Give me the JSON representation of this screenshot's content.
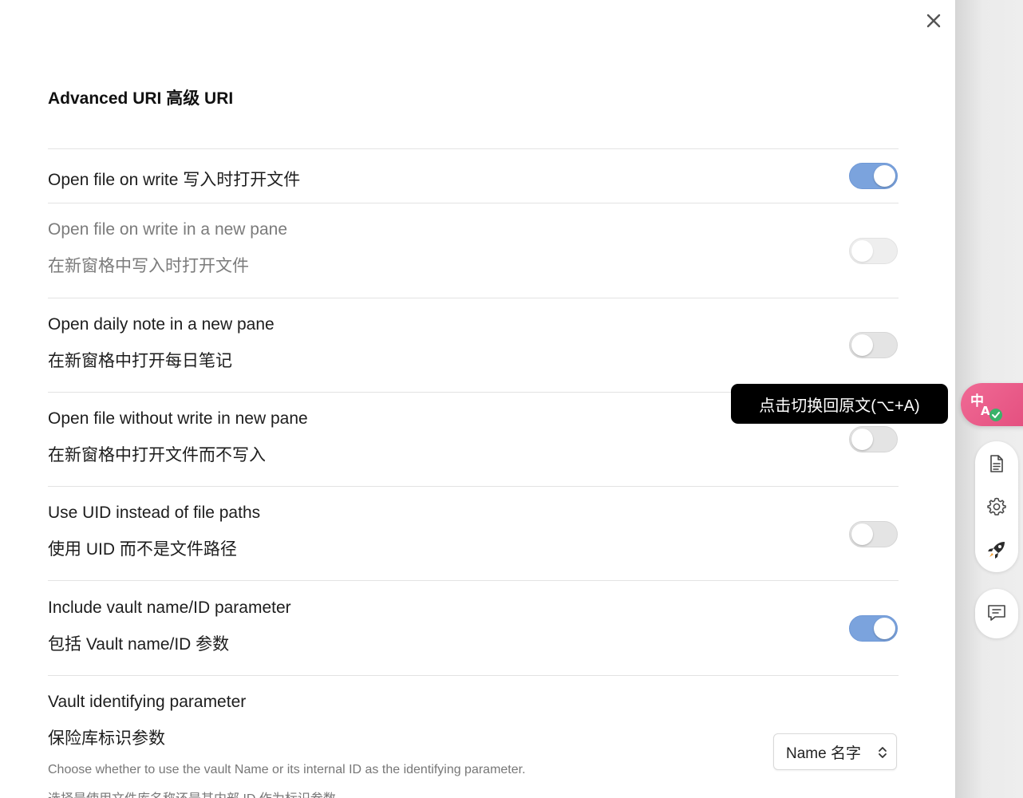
{
  "heading": "Advanced URI  高级 URI",
  "settings": [
    {
      "title": "Open file on write  写入时打开文件",
      "subtitle": "",
      "state": "on"
    },
    {
      "title": "Open file on write in a new pane",
      "subtitle": "在新窗格中写入时打开文件",
      "state": "disabled"
    },
    {
      "title": "Open daily note in a new pane",
      "subtitle": "在新窗格中打开每日笔记",
      "state": "off"
    },
    {
      "title": "Open file without write in new pane",
      "subtitle": "在新窗格中打开文件而不写入",
      "state": "off"
    },
    {
      "title": "Use UID instead of file paths",
      "subtitle": "使用 UID 而不是文件路径",
      "state": "off"
    },
    {
      "title": "Include vault name/ID parameter",
      "subtitle": "包括 Vault name/ID 参数",
      "state": "on"
    }
  ],
  "vault_param": {
    "title": "Vault identifying parameter",
    "subtitle": "保险库标识参数",
    "description": "Choose whether to use the vault Name or its internal ID as the identifying parameter.",
    "description_cn": "选择是使用文件库名称还是其内部 ID 作为标识参数",
    "select_value": "Name  名字"
  },
  "tooltip": "点击切换回原文(⌥+A)",
  "icons": {
    "close": "close-icon",
    "translate": "translate-icon",
    "document": "document-icon",
    "settings": "gear-icon",
    "rocket": "rocket-icon",
    "chat": "chat-icon"
  },
  "colors": {
    "toggle_on": "#7ba3dd",
    "translate_button": "#e85a88",
    "tooltip_bg": "#000000"
  }
}
